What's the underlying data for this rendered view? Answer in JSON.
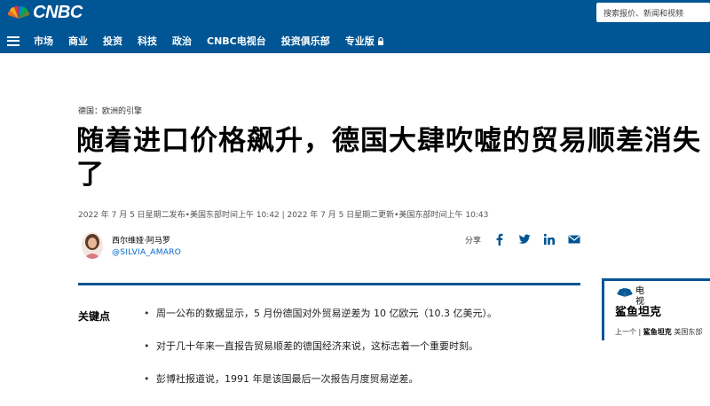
{
  "header": {
    "logo_text": "CNBC",
    "search_placeholder": "搜索报价、新闻和视频",
    "nav": [
      "市场",
      "商业",
      "投资",
      "科技",
      "政治",
      "CNBC电视台",
      "投资俱乐部",
      "专业版"
    ]
  },
  "article": {
    "section": "德国：欧洲的引擎",
    "title": "随着进口价格飙升，德国大肆吹嘘的贸易顺差消失了",
    "dateline": "2022 年 7 月 5 日星期二发布•美国东部时间上午 10:42 | 2022 年 7 月 5 日星期二更新•美国东部时间上午 10:43",
    "author_name": "西尔维娅·阿马罗",
    "author_handle": "@SILVIA_AMARO",
    "share_label": "分享",
    "share_icons": [
      "facebook-icon",
      "twitter-icon",
      "linkedin-icon",
      "email-icon"
    ]
  },
  "key_points": {
    "label": "关键点",
    "items": [
      "周一公布的数据显示，5 月份德国对外贸易逆差为 10 亿欧元（10.3 亿美元）。",
      "对于几十年来一直报告贸易顺差的德国经济来说，这标志着一个重要时刻。",
      "彭博社报道说，1991 年是该国最后一次报告月度贸易逆差。"
    ]
  },
  "tv_widget": {
    "label": "电视",
    "show": "鲨鱼坦克",
    "upnext_label": "上一个 |",
    "upnext_show": "鲨鱼坦克",
    "upnext_time": "美国东部"
  },
  "colors": {
    "brand": "#005594",
    "link": "#0066cc"
  }
}
